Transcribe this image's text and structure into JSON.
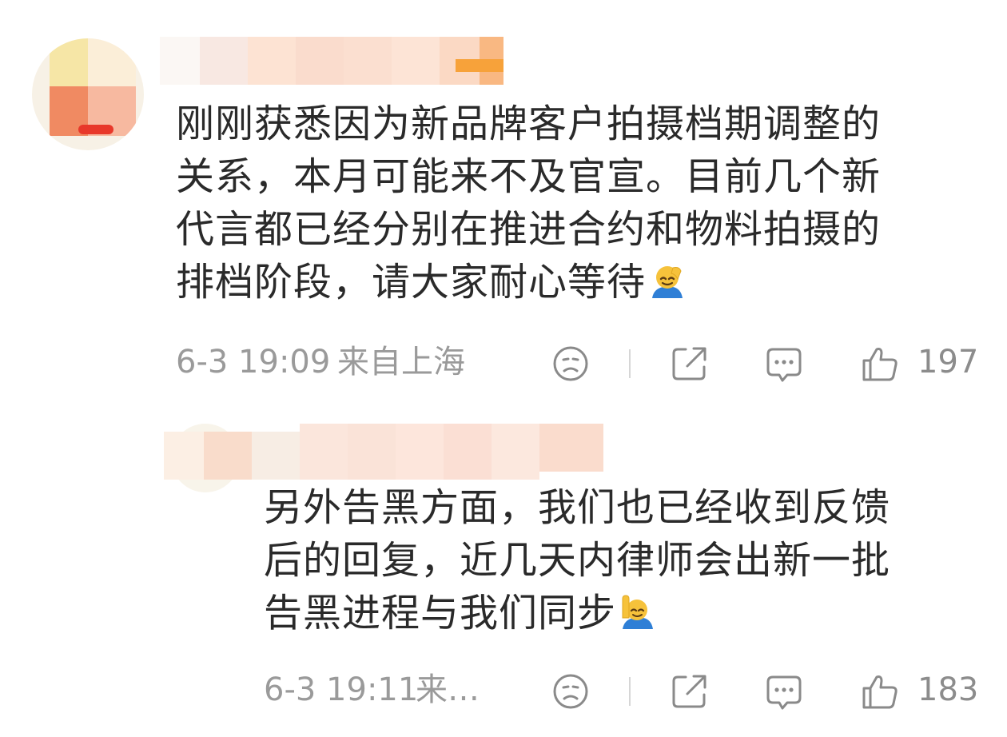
{
  "comments": [
    {
      "text_lines": [
        "刚刚获悉因为新品牌客户拍摄档期调整的",
        "关系，本月可能来不及官宣。目前几个新",
        "代言都已经分别在推进合约和物料拍摄的",
        "排档阶段，请大家耐心等待"
      ],
      "emoji": "saluting-face-emoji",
      "timestamp": "6-3 19:09",
      "location": "来自上海",
      "like_count": "197"
    },
    {
      "text_lines": [
        "另外告黑方面，我们也已经收到反馈",
        "后的回复，近几天内律师会出新一批",
        "告黑进程与我们同步"
      ],
      "emoji": "raising-hand-emoji",
      "timestamp": "6-3 19:11",
      "location": "来…",
      "like_count": "183"
    }
  ],
  "icons": {
    "dislike": "sad-face-icon",
    "share": "share-icon",
    "reply": "comment-icon",
    "like": "thumbs-up-icon"
  },
  "colors": {
    "text": "#2a2a2a",
    "meta": "#9a9a9a",
    "icon": "#8a8a8a",
    "divider": "#d6d6d6"
  }
}
